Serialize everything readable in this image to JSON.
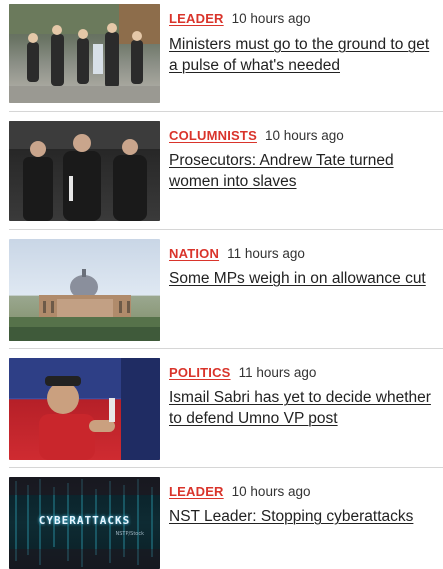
{
  "articles": [
    {
      "category": "LEADER",
      "time": "10 hours ago",
      "headline": "Ministers must go to the ground to get a pulse of what's needed",
      "image": "crowd-photo"
    },
    {
      "category": "COLUMNISTS",
      "time": "10 hours ago",
      "headline": "Prosecutors: Andrew Tate turned women into slaves",
      "image": "courthouse-photo"
    },
    {
      "category": "NATION",
      "time": "11 hours ago",
      "headline": "Some MPs weigh in on allowance cut",
      "image": "building-photo"
    },
    {
      "category": "POLITICS",
      "time": "11 hours ago",
      "headline": "Ismail Sabri has yet to decide whether to defend Umno VP post",
      "image": "politician-photo"
    },
    {
      "category": "LEADER",
      "time": "10 hours ago",
      "headline": "NST Leader: Stopping cyberattacks",
      "image": "cyberattacks-graphic",
      "image_text": "CYBERATTACKS",
      "image_credit": "NSTP/Stock"
    }
  ]
}
